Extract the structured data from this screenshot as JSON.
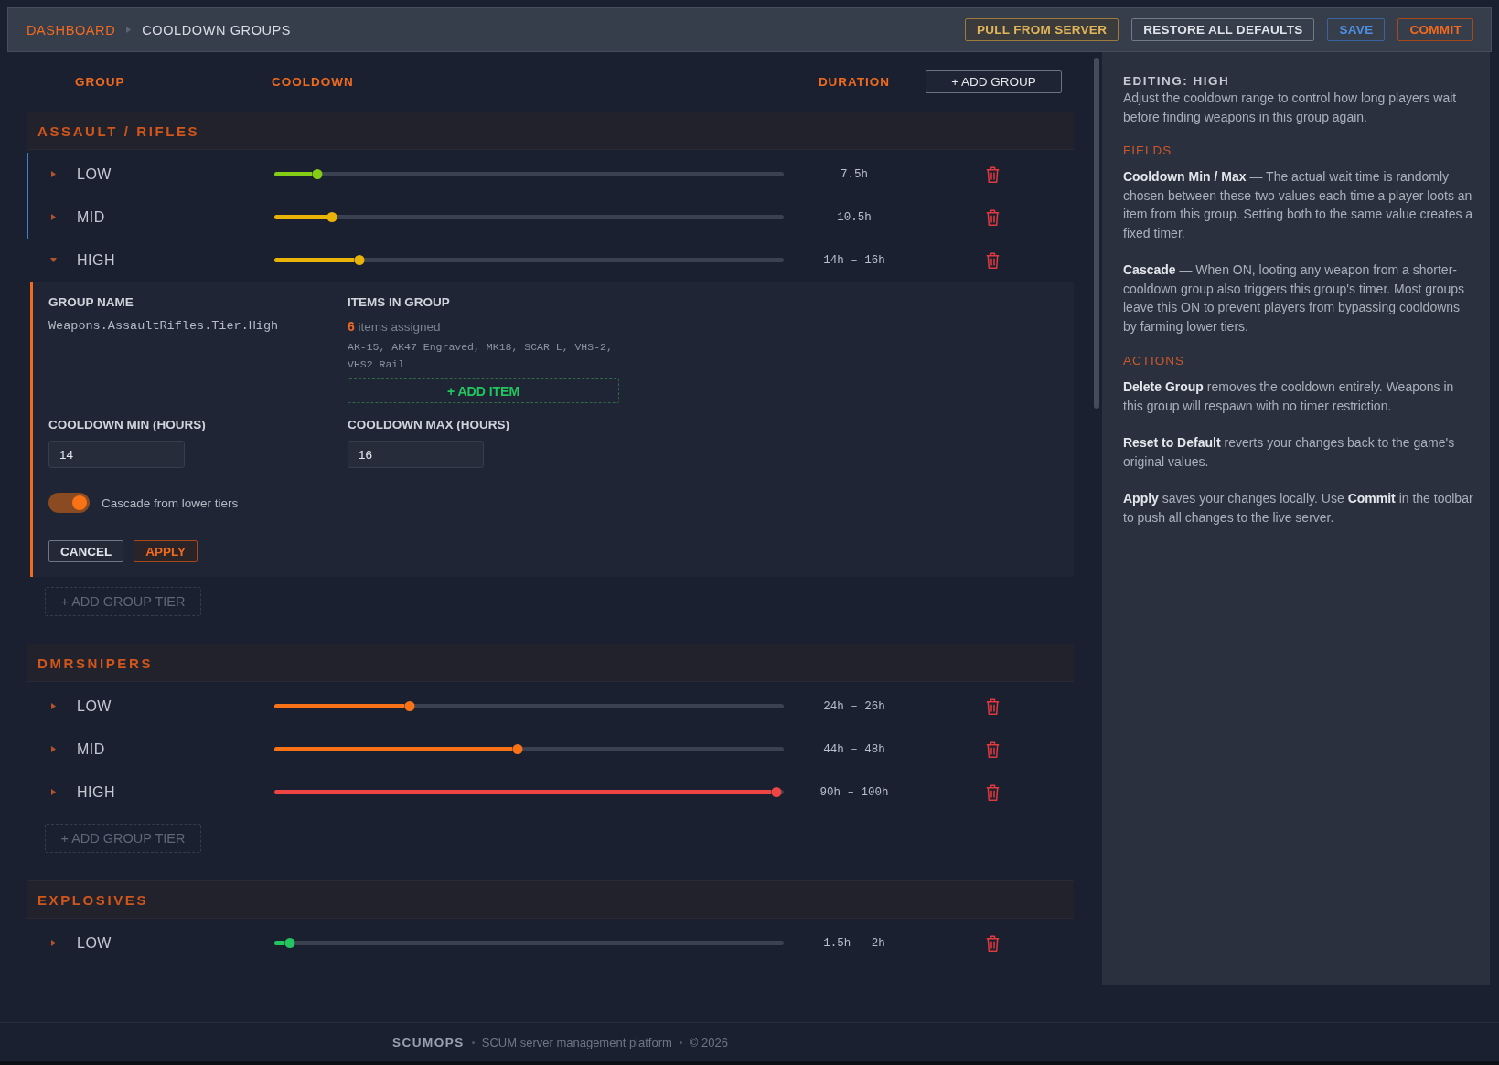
{
  "breadcrumb": [
    {
      "label": "DASHBOARD",
      "current": false
    },
    {
      "label": "COOLDOWN GROUPS",
      "current": true
    }
  ],
  "toolbar": {
    "buttons": [
      {
        "label": "PULL FROM SERVER",
        "kind": "pull"
      },
      {
        "label": "RESTORE ALL DEFAULTS",
        "kind": "restore"
      },
      {
        "label": "SAVE",
        "kind": "save"
      },
      {
        "label": "COMMIT",
        "kind": "commit"
      }
    ]
  },
  "table": {
    "columns": [
      "GROUP",
      "COOLDOWN",
      "DURATION"
    ],
    "add_group_button": "+ ADD GROUP"
  },
  "groups": [
    {
      "name": "ASSAULT / RIFLES",
      "tiers": [
        {
          "label": "LOW",
          "expanded": false,
          "cascade_source": true,
          "level": 0.084,
          "color": "#84cc16",
          "duration": "7.5h"
        },
        {
          "label": "MID",
          "expanded": false,
          "cascade_source": true,
          "level": 0.113,
          "color": "#eab308",
          "duration": "10.5h"
        },
        {
          "label": "HIGH",
          "expanded": true,
          "cascade_source": false,
          "level": 0.167,
          "color": "#eab308",
          "duration": "14h – 16h",
          "editor": {
            "group_name": {
              "label": "GROUP NAME",
              "value": "Weapons.AssaultRifles.Tier.High"
            },
            "items": {
              "label": "ITEMS IN GROUP",
              "count": "6",
              "count_label": "items assigned",
              "list": "AK-15, AK47 Engraved, MK18, SCAR L, VHS-2, VHS2 Rail",
              "add_button": "+ ADD ITEM"
            },
            "min": {
              "label": "COOLDOWN MIN (HOURS)",
              "value": "14"
            },
            "max": {
              "label": "COOLDOWN MAX (HOURS)",
              "value": "16"
            },
            "cascade": {
              "label": "Cascade from lower tiers",
              "on": true
            },
            "buttons": [
              {
                "label": "CANCEL",
                "kind": "cancel"
              },
              {
                "label": "APPLY",
                "kind": "apply"
              }
            ]
          }
        }
      ],
      "add_tier": "+ ADD GROUP TIER"
    },
    {
      "name": "DMRSNIPERS",
      "tiers": [
        {
          "label": "LOW",
          "expanded": false,
          "cascade_source": false,
          "level": 0.265,
          "color": "#f97316",
          "duration": "24h – 26h"
        },
        {
          "label": "MID",
          "expanded": false,
          "cascade_source": false,
          "level": 0.478,
          "color": "#f97316",
          "duration": "44h – 48h"
        },
        {
          "label": "HIGH",
          "expanded": false,
          "cascade_source": false,
          "level": 0.985,
          "color": "#ef4444",
          "duration": "90h – 100h"
        }
      ],
      "add_tier": "+ ADD GROUP TIER"
    },
    {
      "name": "EXPLOSIVES",
      "tiers": [
        {
          "label": "LOW",
          "expanded": false,
          "cascade_source": false,
          "level": 0.03,
          "color": "#22c55e",
          "duration": "1.5h – 2h"
        }
      ]
    }
  ],
  "help_panel": {
    "title": "EDITING: HIGH",
    "intro": "Adjust the cooldown range to control how long players wait before finding weapons in this group again.",
    "sections": [
      {
        "heading": "FIELDS",
        "paragraphs": [
          {
            "text": "**Cooldown Min / Max** — The actual wait time is randomly chosen between these two values each time a player loots an item from this group. Setting both to the same value creates a fixed timer."
          },
          {
            "text": "**Cascade** — When ON, looting any weapon from a shorter-cooldown group also triggers this group's timer. Most groups leave this ON to prevent players from bypassing cooldowns by farming lower tiers."
          }
        ]
      },
      {
        "heading": "ACTIONS",
        "paragraphs": [
          {
            "text": "**Delete Group** removes the cooldown entirely. Weapons in this group will respawn with no timer restriction."
          },
          {
            "text": "**Reset to Default** reverts your changes back to the game's original values."
          },
          {
            "text": "**Apply** saves your changes locally. Use ",
            "accent": "Commit",
            "text_after": " in the toolbar to push all changes to the live server."
          }
        ]
      }
    ]
  },
  "footer": {
    "brand": "SCUMOPS",
    "tagline": "SCUM server management platform",
    "copyright": "© 2026"
  }
}
